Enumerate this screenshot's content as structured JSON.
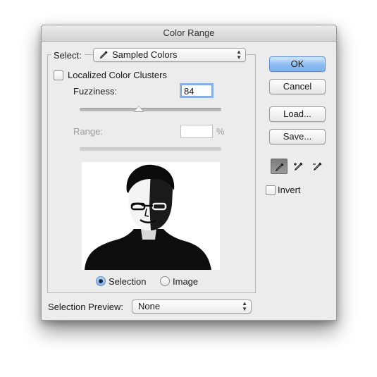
{
  "dialog": {
    "title": "Color Range"
  },
  "select": {
    "label": "Select:",
    "value": "Sampled Colors",
    "icon": "eyedropper-icon"
  },
  "localized": {
    "label": "Localized Color Clusters",
    "checked": false
  },
  "fuzziness": {
    "label": "Fuzziness:",
    "value": "84",
    "slider_level": 0.42
  },
  "range": {
    "label": "Range:",
    "value": "",
    "unit": "%",
    "enabled": false
  },
  "preview": {
    "mode_selection_label": "Selection",
    "mode_image_label": "Image",
    "selected_mode": "Selection"
  },
  "buttons": {
    "ok": "OK",
    "cancel": "Cancel",
    "load": "Load...",
    "save": "Save..."
  },
  "tools": [
    "eyedropper-icon",
    "eyedropper-plus-icon",
    "eyedropper-minus-icon"
  ],
  "invert": {
    "label": "Invert",
    "checked": false
  },
  "selection_preview": {
    "label": "Selection Preview:",
    "value": "None"
  },
  "colors": {
    "default_button": "#8cbcf1",
    "dialog_bg": "#ececec"
  }
}
